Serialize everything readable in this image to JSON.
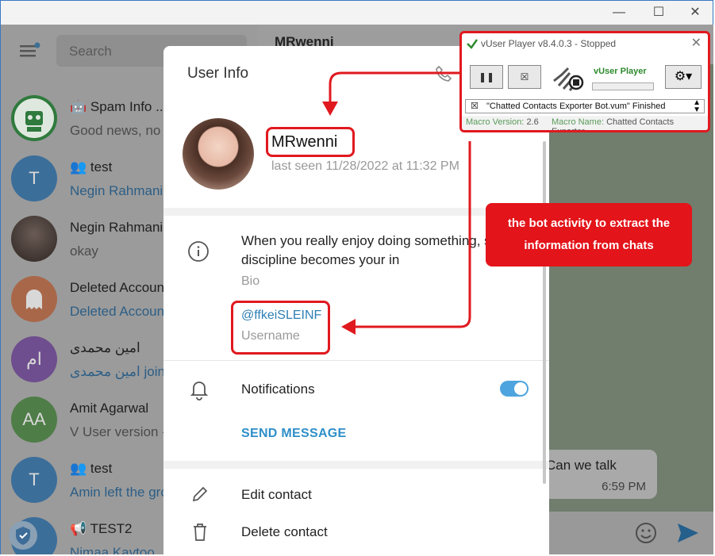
{
  "window": {
    "controls": [
      "minimize",
      "maximize",
      "close"
    ]
  },
  "sidebar": {
    "search_placeholder": "Search",
    "chats": [
      {
        "name": "Spam Info ...",
        "preview": "Good news, no l",
        "icon": "robot-icon",
        "type": "bot"
      },
      {
        "name": "test",
        "preview": "Negin Rahmani",
        "avatar_letter": "T",
        "type": "group"
      },
      {
        "name": "Negin Rahmani",
        "preview": "okay",
        "type": "user"
      },
      {
        "name": "Deleted Accoun",
        "preview": "Deleted Accoun",
        "icon": "ghost-icon",
        "type": "user"
      },
      {
        "name": "امین محمدی",
        "preview": "امین محمدی joine",
        "avatar_letter": "ام",
        "type": "user"
      },
      {
        "name": "Amit Agarwal",
        "preview": "V User version -",
        "avatar_letter": "AA",
        "type": "user"
      },
      {
        "name": "test",
        "preview": "Amin left the gro",
        "avatar_letter": "T",
        "type": "group"
      },
      {
        "name": "TEST2",
        "preview": "Nimaa Kaytoo",
        "type": "channel"
      }
    ]
  },
  "chat": {
    "header_name": "MRwenni",
    "message": {
      "text": "Can we talk",
      "time": "6:59 PM"
    }
  },
  "dialog": {
    "title": "User Info",
    "user_name": "MRwenni",
    "last_seen": "last seen 11/28/2022 at 11:32 PM",
    "bio_line1": "When you really enjoy doing something, s",
    "bio_line2": "discipline becomes your in",
    "bio_label": "Bio",
    "username_value": "@ffkeiSLEINF",
    "username_label": "Username",
    "notifications_label": "Notifications",
    "notifications_on": true,
    "send_message": "SEND MESSAGE",
    "edit_contact": "Edit contact",
    "delete_contact": "Delete contact"
  },
  "annotation": {
    "callout_line1": "the bot activity to extract the",
    "callout_line2": "information from chats",
    "color": "#e0191f"
  },
  "vuser": {
    "title": "vUser Player v8.4.0.3 - Stopped",
    "brand": "vUser Player",
    "status": "\"Chatted Contacts Exporter Bot.vum\" Finished",
    "macro_version_label": "Macro Version:",
    "macro_version": "2.6",
    "macro_name_label": "Macro Name:",
    "macro_name": "Chatted Contacts Exporter"
  },
  "colors": {
    "accent": "#4ea4de",
    "link": "#2e7fb5",
    "red": "#e0191f"
  }
}
